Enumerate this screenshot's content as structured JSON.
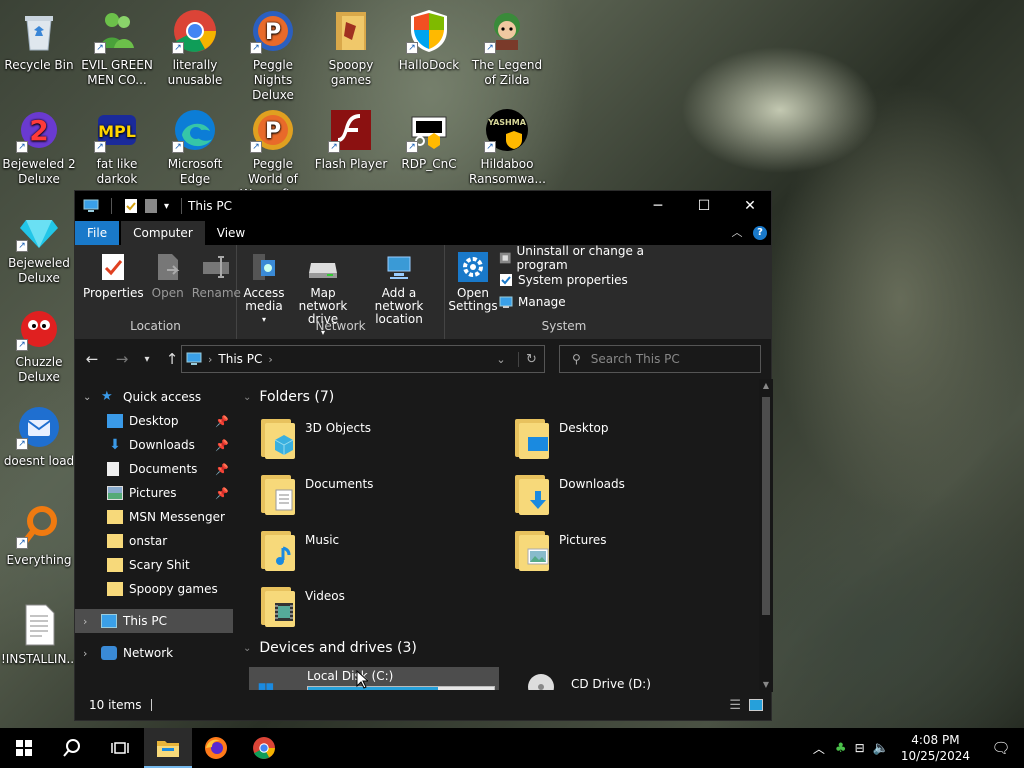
{
  "desktop": {
    "icons": [
      {
        "label": "Recycle Bin"
      },
      {
        "label": "EVIL GREEN MEN CO..."
      },
      {
        "label": "literally unusable"
      },
      {
        "label": "Peggle Nights Deluxe"
      },
      {
        "label": "Spoopy games"
      },
      {
        "label": "HalloDock"
      },
      {
        "label": "The Legend of Zilda"
      },
      {
        "label": "Bejeweled 2 Deluxe"
      },
      {
        "label": "fat like darkok"
      },
      {
        "label": "Microsoft Edge"
      },
      {
        "label": "Peggle World of Warcraft ..."
      },
      {
        "label": "Flash Player"
      },
      {
        "label": "RDP_CnC"
      },
      {
        "label": "Hildaboo Ransomwa..."
      },
      {
        "label": "Bejeweled Deluxe"
      },
      {
        "label": "Chuzzle Deluxe"
      },
      {
        "label": "doesnt load"
      },
      {
        "label": "Everything"
      },
      {
        "label": "!INSTALLIN..."
      }
    ]
  },
  "window": {
    "title": "This PC",
    "controls": {
      "minimize": "─",
      "maximize": "☐",
      "close": "✕"
    },
    "tabs": [
      "File",
      "Computer",
      "View"
    ],
    "ribbon": {
      "location": {
        "label": "Location",
        "buttons": [
          "Properties",
          "Open",
          "Rename"
        ]
      },
      "network": {
        "label": "Network",
        "buttons": [
          "Access media",
          "Map network drive",
          "Add a network location"
        ]
      },
      "system": {
        "label": "System",
        "open_settings": "Open Settings",
        "items": [
          "Uninstall or change a program",
          "System properties",
          "Manage"
        ]
      }
    },
    "address": {
      "path": "This PC",
      "search_placeholder": "Search This PC"
    },
    "nav": {
      "quick_access": "Quick access",
      "items": [
        "Desktop",
        "Downloads",
        "Documents",
        "Pictures",
        "MSN Messenger",
        "onstar",
        "Scary Shit",
        "Spoopy games"
      ],
      "this_pc": "This PC",
      "network": "Network"
    },
    "content": {
      "folders_header": "Folders (7)",
      "folders": [
        "3D Objects",
        "Desktop",
        "Documents",
        "Downloads",
        "Music",
        "Pictures",
        "Videos"
      ],
      "drives_header": "Devices and drives (3)",
      "drives": [
        {
          "name": "Local Disk (C:)",
          "usage_fraction": 0.7
        },
        {
          "name": "CD Drive (D:)"
        }
      ]
    },
    "status": {
      "items_count": "10 items"
    }
  },
  "taskbar": {
    "time": "4:08 PM",
    "date": "10/25/2024"
  },
  "colors": {
    "accent": "#1979ca",
    "window_bg": "#191919",
    "ribbon_bg": "#2b2b2b",
    "drive_bar": "#26a0da",
    "folder": "#f7d97a"
  }
}
